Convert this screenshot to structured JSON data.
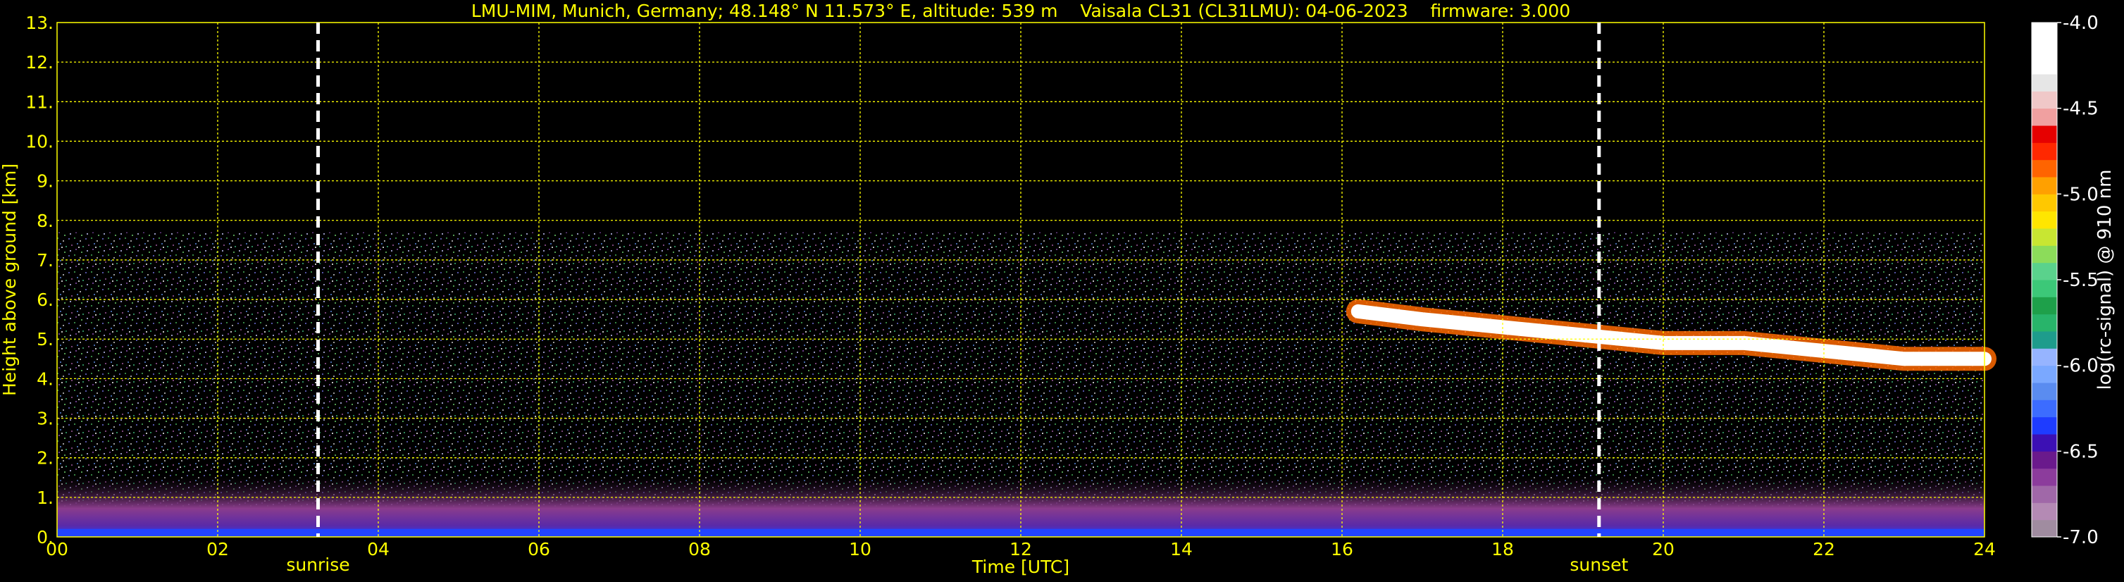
{
  "chart_data": {
    "type": "heatmap",
    "title": "LMU-MIM, Munich, Germany; 48.148° N 11.573° E, altitude: 539 m    Vaisala CL31 (CL31LMU): 04-06-2023    firmware: 3.000",
    "xlabel": "Time [UTC]",
    "ylabel": "Height above ground [km]",
    "xlim": [
      0,
      24
    ],
    "ylim": [
      0,
      13
    ],
    "x_ticks": [
      "00",
      "02",
      "04",
      "06",
      "08",
      "10",
      "12",
      "14",
      "16",
      "18",
      "20",
      "22",
      "24"
    ],
    "y_ticks": [
      "0.",
      "1.",
      "2.",
      "3.",
      "4.",
      "5.",
      "6.",
      "7.",
      "8.",
      "9.",
      "10.",
      "11.",
      "12.",
      "13."
    ],
    "grid": true,
    "markers": [
      {
        "label": "sunrise",
        "time": 3.25
      },
      {
        "label": "sunset",
        "time": 19.2
      }
    ],
    "colorbar": {
      "label": "log(rc-signal) @ 910 nm",
      "range": [
        -7.0,
        -4.0
      ],
      "ticks": [
        "-4.0",
        "-4.5",
        "-5.0",
        "-5.5",
        "-6.0",
        "-6.5",
        "-7.0"
      ]
    },
    "cloud_layer": [
      {
        "time": 16.2,
        "height": 5.7
      },
      {
        "time": 17.0,
        "height": 5.5
      },
      {
        "time": 18.0,
        "height": 5.3
      },
      {
        "time": 19.0,
        "height": 5.1
      },
      {
        "time": 20.0,
        "height": 4.9
      },
      {
        "time": 21.0,
        "height": 4.9
      },
      {
        "time": 22.0,
        "height": 4.7
      },
      {
        "time": 23.0,
        "height": 4.5
      },
      {
        "time": 24.0,
        "height": 4.5
      }
    ],
    "data_top_height": 7.7,
    "colors": {
      "axes_text": "#ffff00",
      "grid": "#ffff00",
      "background": "#000000",
      "marker_line": "#ffffff"
    }
  }
}
